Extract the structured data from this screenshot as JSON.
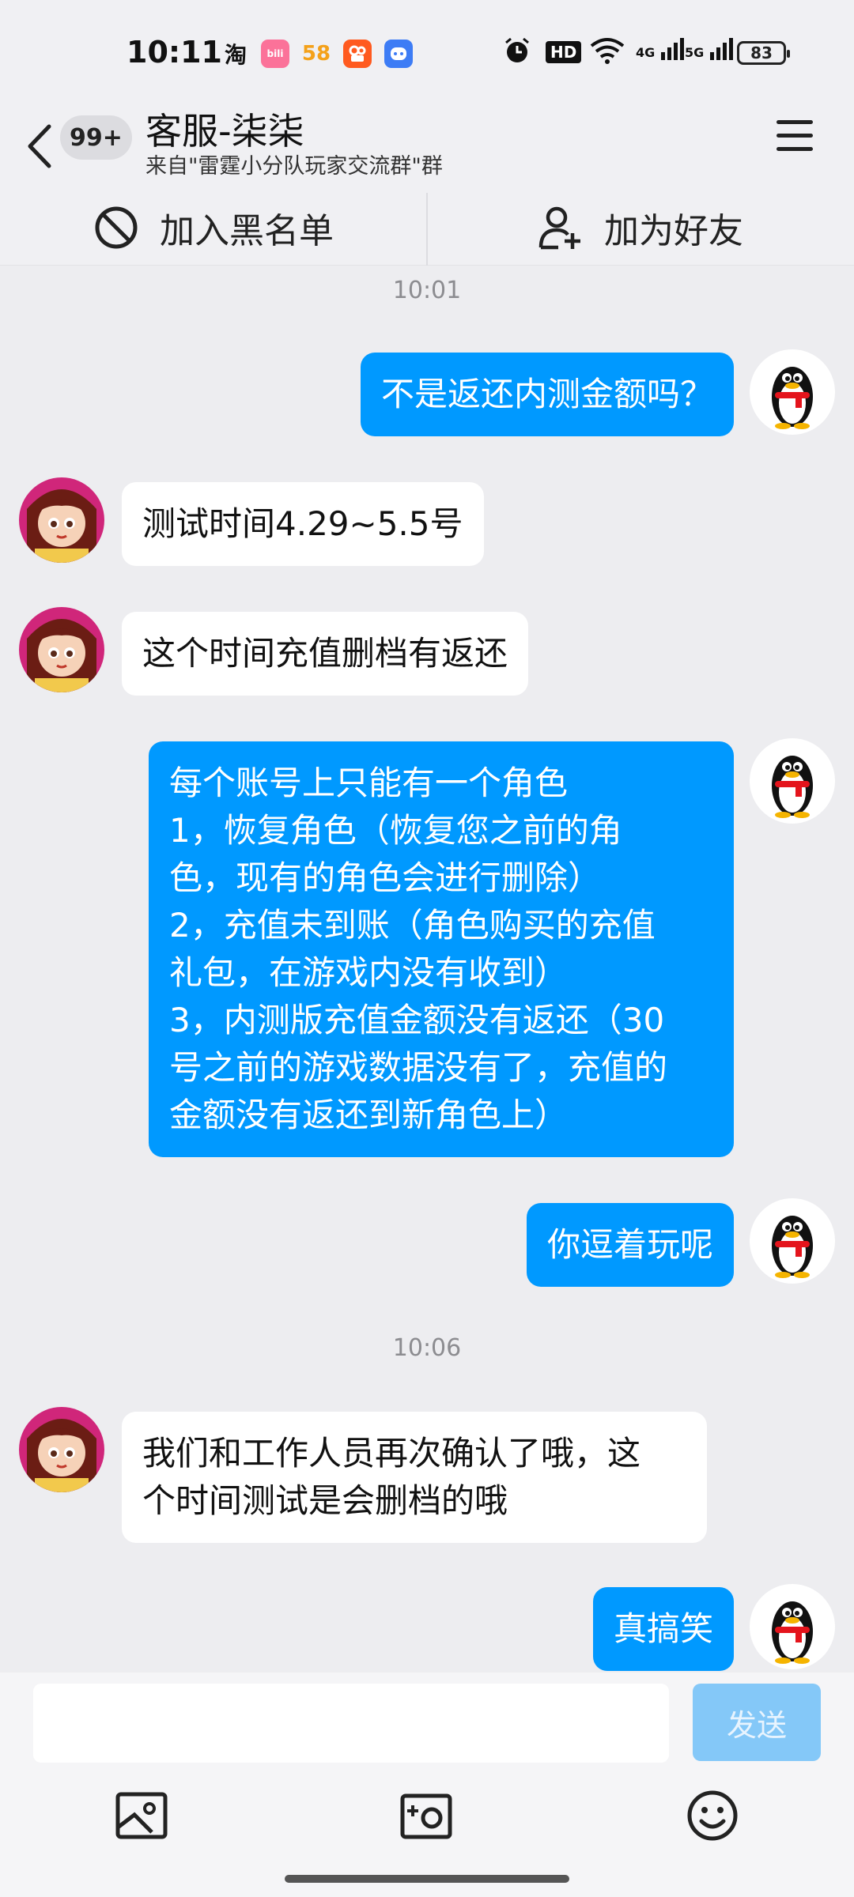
{
  "status_bar": {
    "time": "10:11",
    "apps": [
      {
        "name": "taobao-icon",
        "label": "淘"
      },
      {
        "name": "bilibili-icon",
        "label": "bili"
      },
      {
        "name": "58-icon",
        "label": "58"
      },
      {
        "name": "kuaishou-icon",
        "label": ""
      },
      {
        "name": "game-icon",
        "label": ""
      }
    ],
    "hd_label": "HD",
    "net1": "4G",
    "net2": "5G",
    "battery": "83"
  },
  "header": {
    "unread_badge": "99+",
    "title": "客服-柒柒",
    "subtitle": "来自\"雷霆小分队玩家交流群\"群"
  },
  "actions": {
    "block": "加入黑名单",
    "add_friend": "加为好友"
  },
  "chat": {
    "timestamps": [
      "10:01",
      "10:06"
    ],
    "messages": [
      {
        "side": "out",
        "text": "不是返还内测金额吗？"
      },
      {
        "side": "in",
        "text": "测试时间4.29~5.5号"
      },
      {
        "side": "in",
        "text": "这个时间充值删档有返还"
      },
      {
        "side": "out",
        "text": "每个账号上只能有一个角色\n1，恢复角色（恢复您之前的角\n色，现有的角色会进行删除）\n2，充值未到账（角色购买的充值\n礼包，在游戏内没有收到）\n3，内测版充值金额没有返还（30\n号之前的游戏数据没有了，充值的\n金额没有返还到新角色上）"
      },
      {
        "side": "out",
        "text": "你逗着玩呢"
      },
      {
        "side": "in",
        "text": "我们和工作人员再次确认了哦，这\n个时间测试是会删档的哦"
      },
      {
        "side": "out",
        "text": "真搞笑"
      }
    ]
  },
  "input": {
    "value": "",
    "send_label": "发送"
  },
  "colors": {
    "outgoing_bubble": "#0099ff",
    "incoming_bubble": "#ffffff",
    "send_button": "#84c8f8"
  }
}
